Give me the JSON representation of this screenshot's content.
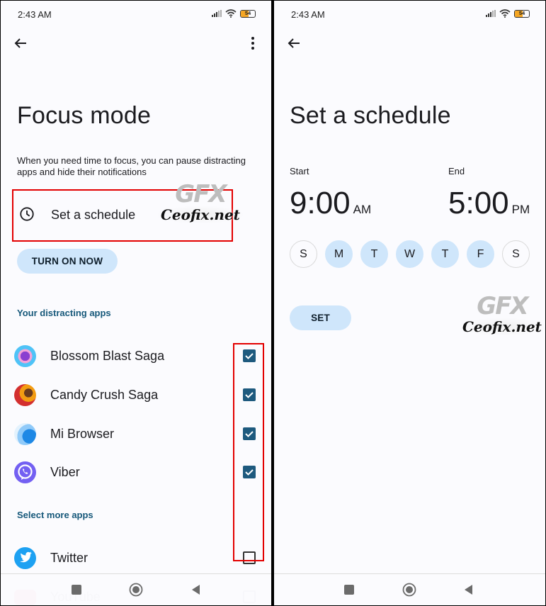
{
  "status_bar": {
    "time": "2:43 AM",
    "battery": "54",
    "icons": [
      "signal-icon",
      "wifi-icon",
      "battery-icon"
    ]
  },
  "focus_mode": {
    "title": "Focus mode",
    "description": "When you need time to focus, you can pause distracting apps and hide their notifications",
    "schedule_label": "Set a schedule",
    "turn_on_label": "TURN ON NOW",
    "distracting_header": "Your distracting apps",
    "distracting_apps": [
      {
        "name": "Blossom Blast Saga",
        "checked": true
      },
      {
        "name": "Candy Crush Saga",
        "checked": true
      },
      {
        "name": "Mi Browser",
        "checked": true
      },
      {
        "name": "Viber",
        "checked": true
      }
    ],
    "more_header": "Select more apps",
    "more_apps": [
      {
        "name": "Twitter",
        "checked": false
      },
      {
        "name": "YouTube",
        "checked": false
      }
    ]
  },
  "schedule": {
    "title": "Set a schedule",
    "start_label": "Start",
    "start_time": "9:00",
    "start_ampm": "AM",
    "end_label": "End",
    "end_time": "5:00",
    "end_ampm": "PM",
    "days": [
      {
        "label": "S",
        "selected": false
      },
      {
        "label": "M",
        "selected": true
      },
      {
        "label": "T",
        "selected": true
      },
      {
        "label": "W",
        "selected": true
      },
      {
        "label": "T",
        "selected": true
      },
      {
        "label": "F",
        "selected": true
      },
      {
        "label": "S",
        "selected": false
      }
    ],
    "set_label": "SET"
  },
  "watermark": {
    "logo": "GFX",
    "site": "Ceofix.net"
  },
  "colors": {
    "accent_blue": "#cfe6fb",
    "checkbox": "#1e5a7e",
    "section_header": "#16587a",
    "highlight_red": "#e30000"
  }
}
